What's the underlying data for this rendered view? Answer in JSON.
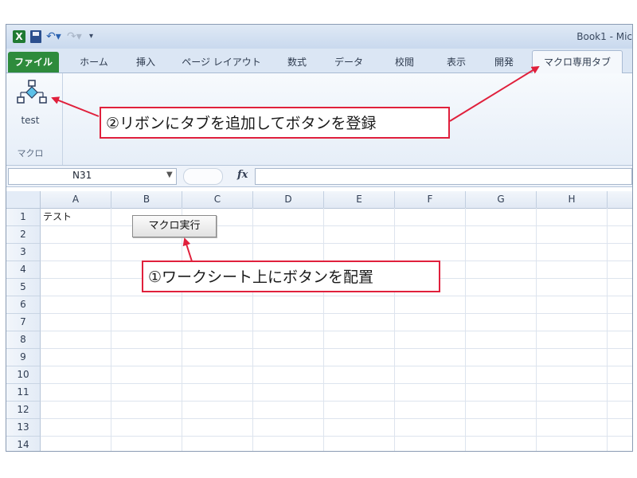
{
  "window": {
    "title": "Book1 - Mic"
  },
  "tabs": {
    "file": "ファイル",
    "items": [
      "ホーム",
      "挿入",
      "ページ レイアウト",
      "数式",
      "データ",
      "校閲",
      "表示",
      "開発"
    ],
    "active": "マクロ専用タブ"
  },
  "ribbon": {
    "macro_button_label": "test",
    "group_label": "マクロ"
  },
  "formula_bar": {
    "name_box": "N31",
    "fx": "fx"
  },
  "sheet": {
    "columns": [
      "A",
      "B",
      "C",
      "D",
      "E",
      "F",
      "G",
      "H"
    ],
    "rows": [
      "1",
      "2",
      "3",
      "4",
      "5",
      "6",
      "7",
      "8",
      "9",
      "10",
      "11",
      "12",
      "13",
      "14"
    ],
    "cell_a1": "テスト",
    "form_button_label": "マクロ実行"
  },
  "annotations": {
    "ribbon_note": "②リボンにタブを追加してボタンを登録",
    "sheet_note": "①ワークシート上にボタンを配置"
  },
  "colors": {
    "accent_red": "#e0203c",
    "file_tab_green": "#2e8b3c"
  }
}
